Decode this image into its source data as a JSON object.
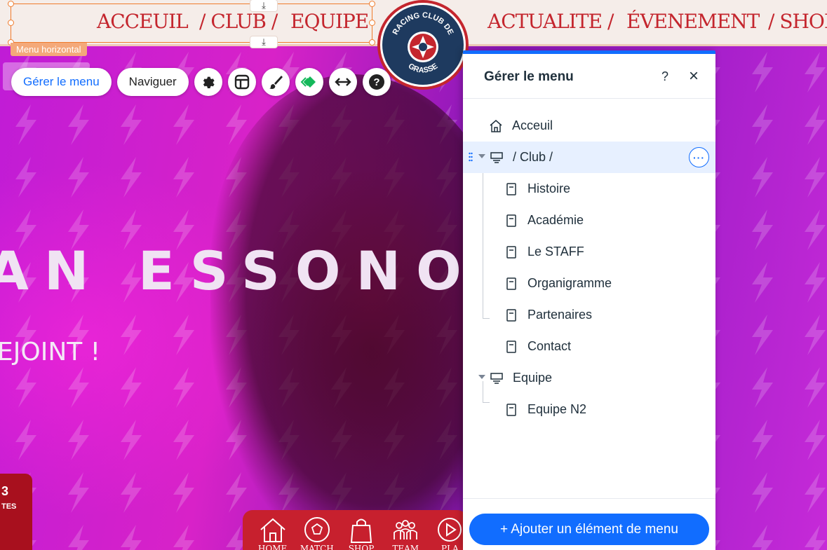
{
  "topnav": {
    "items": [
      {
        "label": "ACCEUIL"
      },
      {
        "label": "/ CLUB /"
      },
      {
        "label": "EQUIPE"
      },
      {
        "label": "ACTUALITE /"
      },
      {
        "label": "ÉVENEMENT"
      },
      {
        "label": "/ SHOP"
      }
    ],
    "selection_label": "Menu horizontal",
    "logo_text_top": "RACING CLUB DE",
    "logo_text_bottom": "GRASSE"
  },
  "toolbar": {
    "manage_menu_label": "Gérer le menu",
    "navigate_label": "Naviguer",
    "icons": [
      "gear-icon",
      "layout-icon",
      "brush-icon",
      "animation-icon",
      "stretch-icon",
      "help-icon"
    ]
  },
  "hero": {
    "title": "AN ESSONO",
    "subtitle": "EJOINT !",
    "stat_big": "3",
    "stat_small": "TES"
  },
  "bottom_nav": [
    {
      "label": "HOME"
    },
    {
      "label": "MATCH"
    },
    {
      "label": "SHOP"
    },
    {
      "label": "TEAM"
    },
    {
      "label": "PLA"
    }
  ],
  "panel": {
    "title": "Gérer le menu",
    "help": "?",
    "close": "×",
    "items": [
      {
        "label": "Acceuil",
        "type": "home"
      },
      {
        "label": "/ Club /",
        "type": "folder"
      },
      {
        "label": "Histoire",
        "type": "page"
      },
      {
        "label": "Académie",
        "type": "page"
      },
      {
        "label": "Le STAFF",
        "type": "page"
      },
      {
        "label": "Organigramme",
        "type": "page"
      },
      {
        "label": "Partenaires",
        "type": "page"
      },
      {
        "label": "Contact",
        "type": "page"
      },
      {
        "label": "Equipe",
        "type": "folder"
      },
      {
        "label": "Equipe N2",
        "type": "page"
      }
    ],
    "more_label": "···",
    "add_button": "+ Ajouter un élément de menu"
  },
  "colors": {
    "accent": "#116dff",
    "brand_red": "#c4262e",
    "selection_orange": "#f07b2c",
    "logo_navy": "#1e3a5f"
  }
}
